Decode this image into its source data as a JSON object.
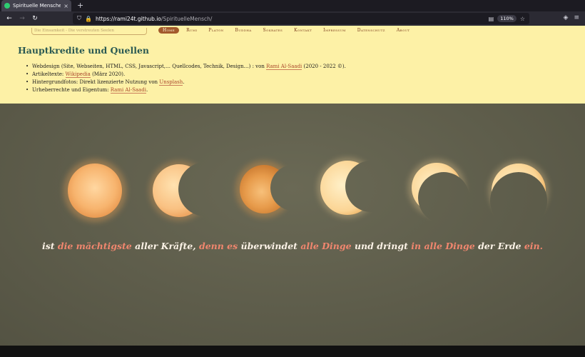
{
  "browser": {
    "tab_title": "Spirituelle Menschen",
    "tab_close": "×",
    "new_tab": "+",
    "url_host": "https://rami24t.github.io",
    "url_path": "/SpirituelleMensch/",
    "zoom": "110%"
  },
  "nav": {
    "items": [
      "Home",
      "Rumi",
      "Platon",
      "Buddha",
      "Sokrates",
      "Kontakt",
      "Impressum",
      "Datenschutz",
      "About"
    ]
  },
  "credits": {
    "cutoff_text": "Die Einsamkeit - Die verstreuten Seelen",
    "heading": "Hauptkredite und Quellen",
    "items": [
      {
        "text": "Webdesign (Site, Webseiten, HTML, CSS, Javascript,… Quellcodes, Technik, Design…) : von ",
        "link": "Rami Al-Saadi",
        "suffix": " (2020 - 2022 ©)."
      },
      {
        "text": "Artikeltexte: ",
        "link": "Wikipedia",
        "suffix": " (März 2020)."
      },
      {
        "text": "Hintergrundfotos: Direkt lizenzierte Nutzung von ",
        "link": "Unsplash",
        "suffix": "."
      },
      {
        "text": "Urheberrechte und Eigentum: ",
        "link": "Rami Al-Saadi",
        "suffix": "."
      }
    ]
  },
  "quote": {
    "parts": [
      {
        "t": "ist ",
        "hl": false
      },
      {
        "t": "die mächtigste",
        "hl": true
      },
      {
        "t": " aller Kräfte, ",
        "hl": false
      },
      {
        "t": "denn es",
        "hl": true
      },
      {
        "t": " überwindet ",
        "hl": false
      },
      {
        "t": "alle Dinge",
        "hl": true
      },
      {
        "t": " und dringt ",
        "hl": false
      },
      {
        "t": "in alle Dinge",
        "hl": true
      },
      {
        "t": " der Erde ",
        "hl": false
      },
      {
        "t": "ein.",
        "hl": true
      }
    ]
  },
  "colors": {
    "accent": "#a35a2c",
    "link": "#a8452a",
    "heading": "#2b5a53",
    "quote_highlight": "#f0866e",
    "credits_bg": "#fdf1a6",
    "hero_bg": "#5d5c4c"
  },
  "icons": {
    "back": "arrow-left-icon",
    "forward": "arrow-right-icon",
    "reload": "reload-icon",
    "shield": "shield-icon",
    "lock": "lock-icon",
    "reader": "reader-view-icon",
    "bookmark": "star-icon",
    "pocket": "pocket-icon",
    "menu": "hamburger-menu-icon"
  }
}
